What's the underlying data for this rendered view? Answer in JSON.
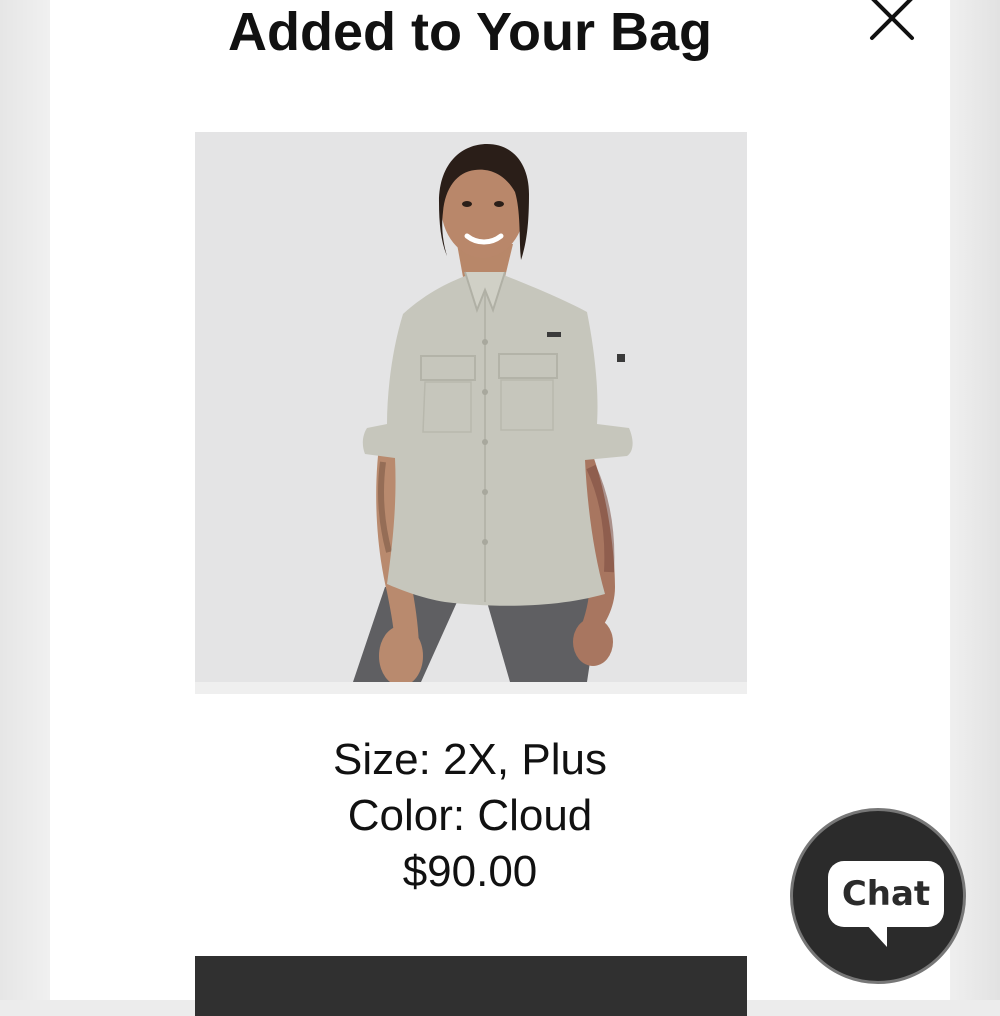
{
  "modal": {
    "title": "Added to Your Bag",
    "close_icon": "close-icon"
  },
  "product": {
    "image_icon": "product-photo",
    "size": "Size: 2X, Plus",
    "color": "Color: Cloud",
    "price": "$90.00"
  },
  "chat": {
    "label": "Chat",
    "icon": "chat-bubble-icon"
  },
  "colors": {
    "modal_background": "#ffffff",
    "primary_button": "#303030",
    "chat_button": "#2b2b2b",
    "shirt": "#c6c6bc"
  }
}
